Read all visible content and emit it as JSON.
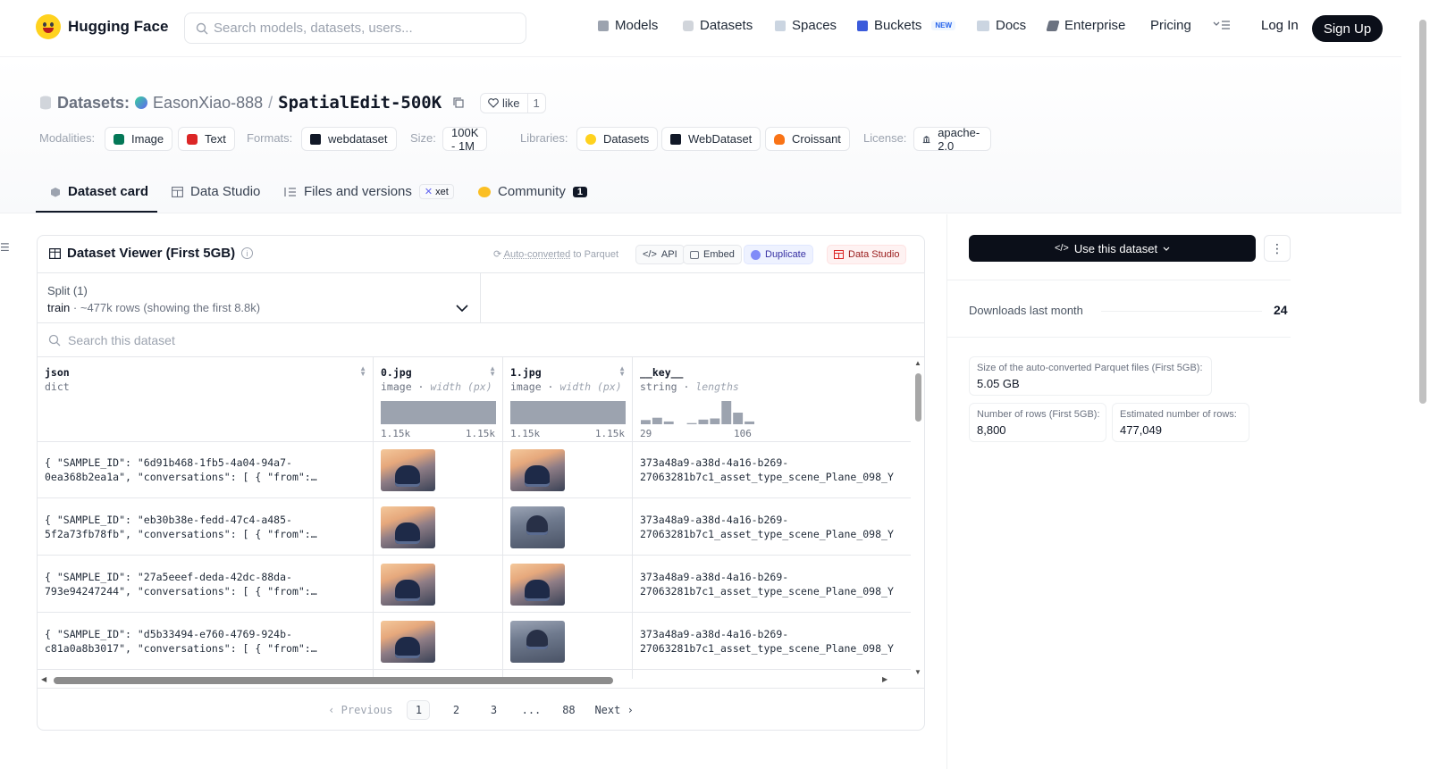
{
  "header": {
    "brand": "Hugging Face",
    "search_placeholder": "Search models, datasets, users...",
    "nav": [
      "Models",
      "Datasets",
      "Spaces",
      "Buckets",
      "Docs",
      "Enterprise",
      "Pricing"
    ],
    "buckets_badge": "NEW",
    "login": "Log In",
    "signup": "Sign Up"
  },
  "repo": {
    "type_label": "Datasets:",
    "owner": "EasonXiao-888",
    "separator": "/",
    "name": "SpatialEdit-500K",
    "like_label": "like",
    "like_count": "1"
  },
  "tags": {
    "modalities_label": "Modalities:",
    "modalities": [
      "Image",
      "Text"
    ],
    "formats_label": "Formats:",
    "formats": [
      "webdataset"
    ],
    "size_label": "Size:",
    "size": "100K - 1M",
    "libraries_label": "Libraries:",
    "libraries": [
      "Datasets",
      "WebDataset",
      "Croissant"
    ],
    "license_label": "License:",
    "license": "apache-2.0"
  },
  "tabs": {
    "card": "Dataset card",
    "studio": "Data Studio",
    "files": "Files and versions",
    "xet": "xet",
    "community": "Community",
    "community_count": "1"
  },
  "viewer": {
    "title": "Dataset Viewer (First 5GB)",
    "autoconv_link": "Auto-converted",
    "autoconv_rest": " to Parquet",
    "btn_api": "API",
    "btn_embed": "Embed",
    "btn_duplicate": "Duplicate",
    "btn_datastudio": "Data Studio",
    "split_label": "Split (1)",
    "split_name": "train",
    "split_info": "· ~477k rows (showing the first 8.8k)",
    "search_placeholder": "Search this dataset",
    "columns": [
      {
        "name": "json",
        "type": "dict",
        "stat": ""
      },
      {
        "name": "0.jpg",
        "type": "image",
        "stat": "width (px)",
        "min": "1.15k",
        "max": "1.15k"
      },
      {
        "name": "1.jpg",
        "type": "image",
        "stat": "width (px)",
        "min": "1.15k",
        "max": "1.15k"
      },
      {
        "name": "__key__",
        "type": "string",
        "stat": "lengths",
        "min": "29",
        "max": "106"
      }
    ],
    "rows": [
      {
        "json": "{ \"SAMPLE_ID\": \"6d91b468-1fb5-4a04-94a7-\n0ea368b2ea1a\", \"conversations\": [ { \"from\":…",
        "key": "373a48a9-a38d-4a16-b269-\n27063281b7c1_asset_type_scene_Plane_098_Y"
      },
      {
        "json": "{ \"SAMPLE_ID\": \"eb30b38e-fedd-47c4-a485-\n5f2a73fb78fb\", \"conversations\": [ { \"from\":…",
        "key": "373a48a9-a38d-4a16-b269-\n27063281b7c1_asset_type_scene_Plane_098_Y"
      },
      {
        "json": "{ \"SAMPLE_ID\": \"27a5eeef-deda-42dc-88da-\n793e94247244\", \"conversations\": [ { \"from\":…",
        "key": "373a48a9-a38d-4a16-b269-\n27063281b7c1_asset_type_scene_Plane_098_Y"
      },
      {
        "json": "{ \"SAMPLE_ID\": \"d5b33494-e760-4769-924b-\nc81a0a8b3017\", \"conversations\": [ { \"from\":…",
        "key": "373a48a9-a38d-4a16-b269-\n27063281b7c1_asset_type_scene_Plane_098_Y"
      }
    ],
    "key_histogram": [
      0.18,
      0.28,
      0.12,
      0,
      0.05,
      0.2,
      0.25,
      1.0,
      0.5,
      0.12
    ],
    "pager": {
      "prev": "Previous",
      "pages": [
        "1",
        "2",
        "3",
        "...",
        "88"
      ],
      "next": "Next",
      "current": "1"
    }
  },
  "sidebar": {
    "use_button": "Use this dataset",
    "downloads_label": "Downloads last month",
    "downloads_value": "24",
    "parquet_label": "Size of the auto-converted Parquet files (First 5GB):",
    "parquet_value": "5.05 GB",
    "rows_label": "Number of rows (First 5GB):",
    "rows_value": "8,800",
    "est_label": "Estimated number of rows:",
    "est_value": "477,049"
  }
}
